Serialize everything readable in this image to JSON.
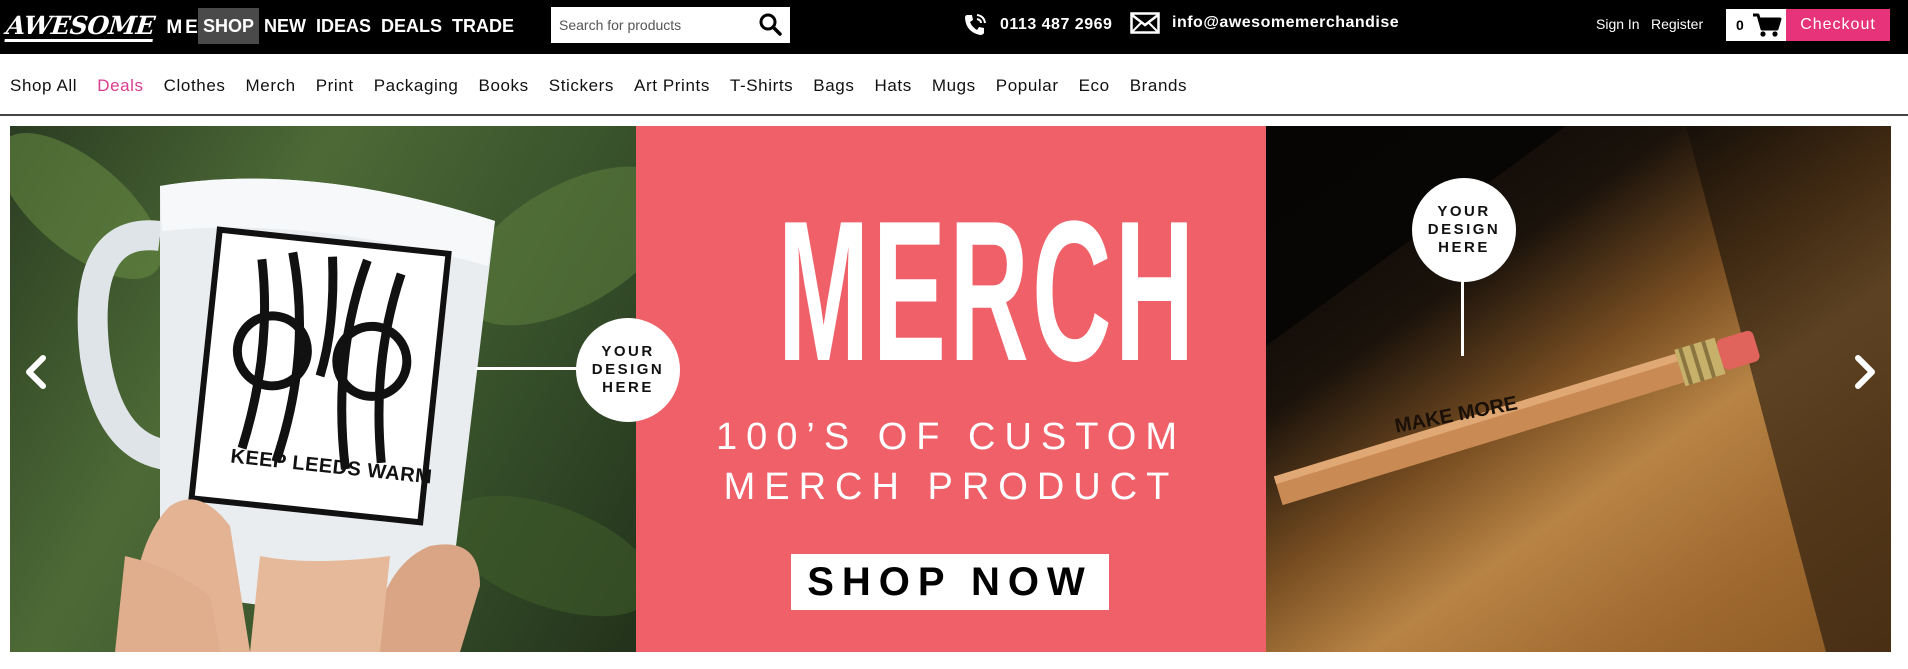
{
  "header": {
    "logo_word1": "AWESOME",
    "logo_word2": "MERCH",
    "nav": [
      {
        "label": "SHOP",
        "active": true
      },
      {
        "label": "NEW"
      },
      {
        "label": "IDEAS"
      },
      {
        "label": "DEALS"
      },
      {
        "label": "TRADE"
      }
    ],
    "search": {
      "placeholder": "Search for products",
      "value": ""
    },
    "phone": "0113 487 2969",
    "email": "info@awesomemerchandise",
    "sign_in": "Sign In",
    "register": "Register",
    "cart_count": "0",
    "checkout": "Checkout"
  },
  "categories": [
    "Shop All",
    "Deals",
    "Clothes",
    "Merch",
    "Print",
    "Packaging",
    "Books",
    "Stickers",
    "Art Prints",
    "T-Shirts",
    "Bags",
    "Hats",
    "Mugs",
    "Popular",
    "Eco",
    "Brands"
  ],
  "hero": {
    "title": "MERCH",
    "tagline_1": "100’S OF CUSTOM",
    "tagline_2": "MERCH PRODUCT",
    "cta": "SHOP NOW",
    "badge_1": [
      "YOUR",
      "DESIGN",
      "HERE"
    ],
    "badge_2": [
      "YOUR",
      "DESIGN",
      "HERE"
    ],
    "mug_print": "KEEP LEEDS WARM",
    "pencil_print": "MAKE MORE"
  },
  "colors": {
    "accent": "#e6337a",
    "hero_mid": "#f06068",
    "deal_link": "#d63c8f"
  }
}
